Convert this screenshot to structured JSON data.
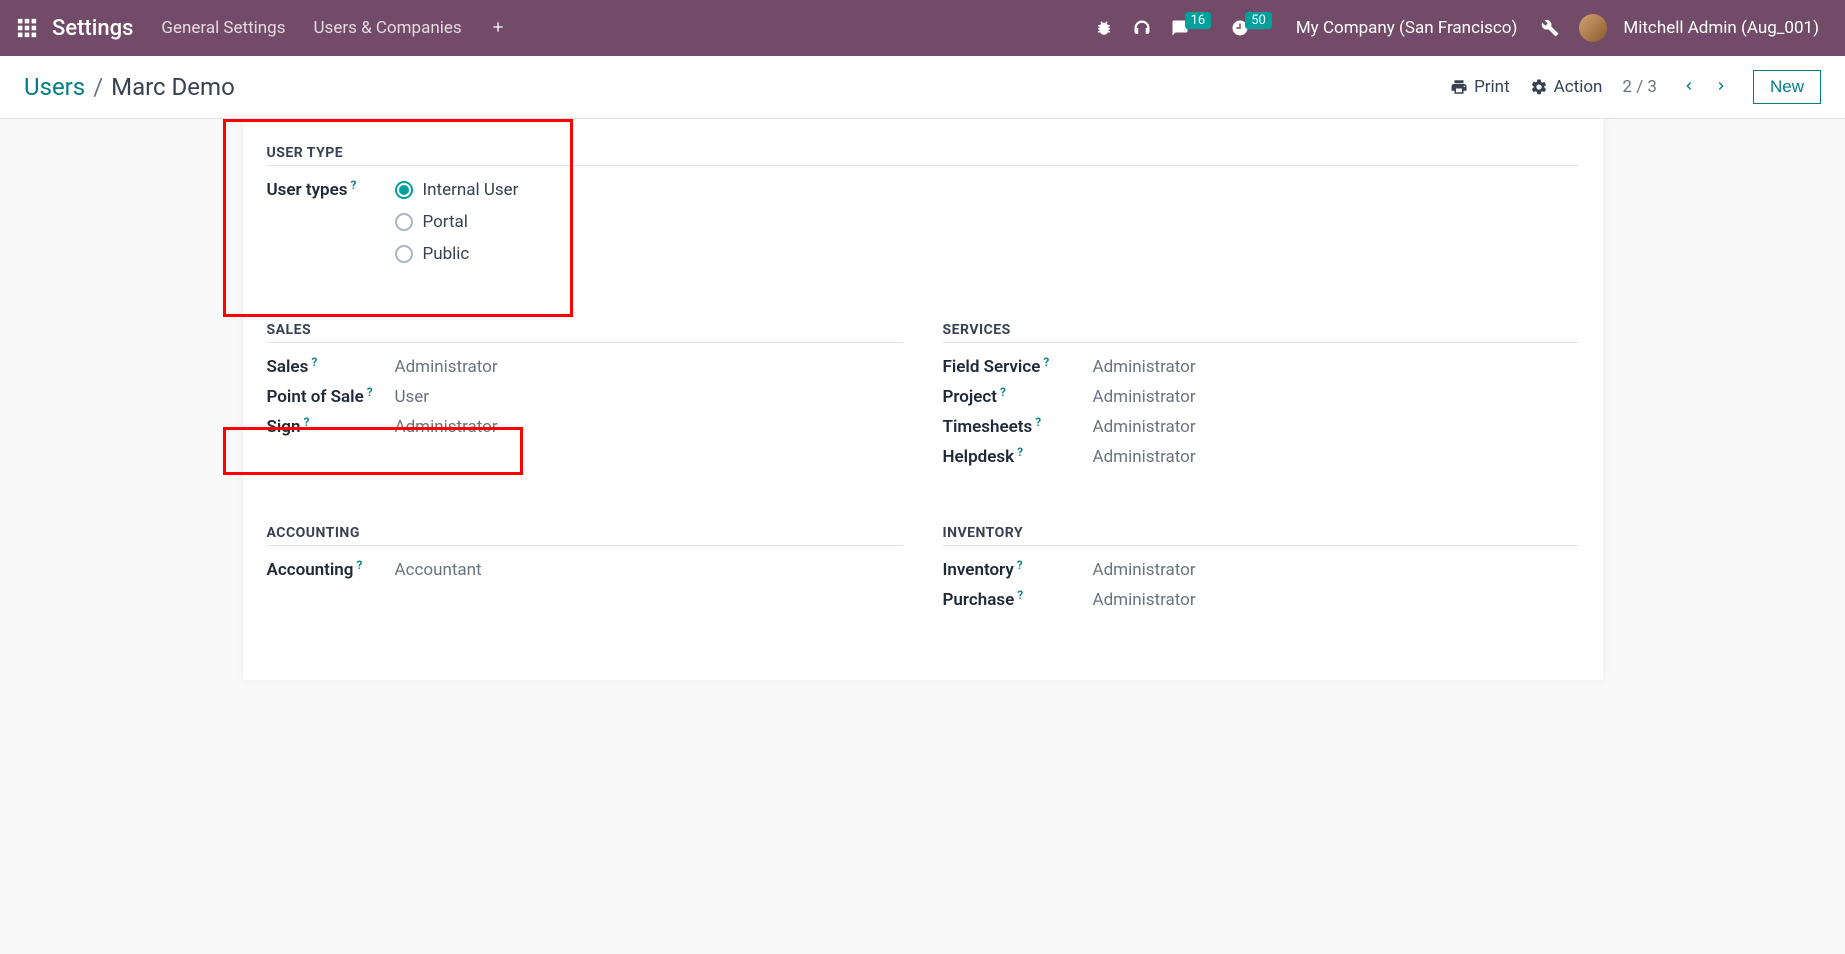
{
  "topnav": {
    "brand": "Settings",
    "menu": [
      "General Settings",
      "Users & Companies"
    ],
    "badges": {
      "messages": "16",
      "activities": "50"
    },
    "company": "My Company (San Francisco)",
    "user": "Mitchell Admin (Aug_001)"
  },
  "controlpanel": {
    "breadcrumb_root": "Users",
    "breadcrumb_current": "Marc Demo",
    "print": "Print",
    "action": "Action",
    "pager": "2 / 3",
    "new": "New"
  },
  "sections": {
    "user_type": {
      "title": "USER TYPE",
      "label": "User types",
      "options": [
        "Internal User",
        "Portal",
        "Public"
      ],
      "selected": 0
    },
    "sales": {
      "title": "SALES",
      "rows": [
        {
          "label": "Sales",
          "value": "Administrator"
        },
        {
          "label": "Point of Sale",
          "value": "User"
        },
        {
          "label": "Sign",
          "value": "Administrator"
        }
      ]
    },
    "services": {
      "title": "SERVICES",
      "rows": [
        {
          "label": "Field Service",
          "value": "Administrator"
        },
        {
          "label": "Project",
          "value": "Administrator"
        },
        {
          "label": "Timesheets",
          "value": "Administrator"
        },
        {
          "label": "Helpdesk",
          "value": "Administrator"
        }
      ]
    },
    "accounting": {
      "title": "ACCOUNTING",
      "rows": [
        {
          "label": "Accounting",
          "value": "Accountant"
        }
      ]
    },
    "inventory": {
      "title": "INVENTORY",
      "rows": [
        {
          "label": "Inventory",
          "value": "Administrator"
        },
        {
          "label": "Purchase",
          "value": "Administrator"
        }
      ]
    }
  }
}
